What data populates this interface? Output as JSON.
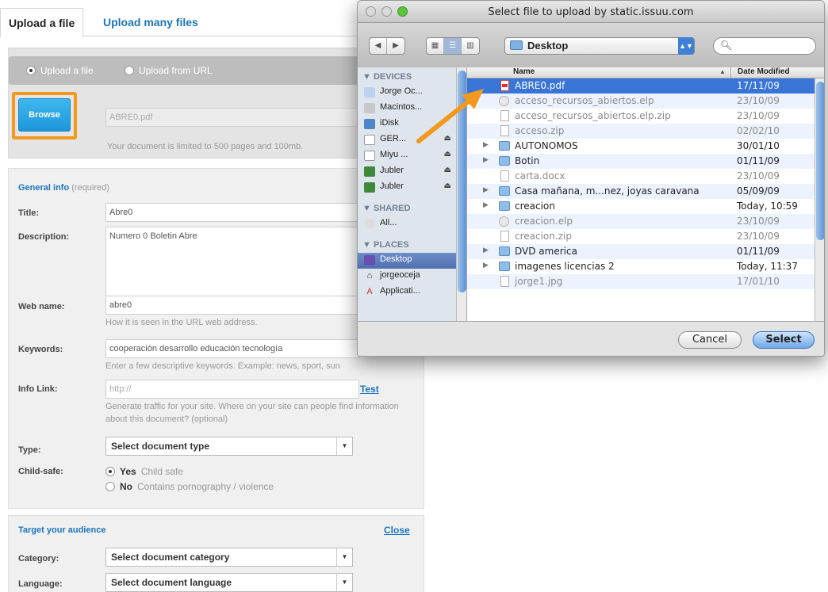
{
  "tabs": {
    "active": "Upload a file",
    "other": "Upload many files"
  },
  "upload": {
    "radio_file": "Upload a file",
    "radio_url": "Upload from URL",
    "browse_label": "Browse",
    "file_value": "ABRE0.pdf",
    "limit_hint": "Your document is limited to 500 pages and 100mb."
  },
  "general": {
    "title": "General info",
    "required": "(required)",
    "title_label": "Title:",
    "title_value": "Abre0",
    "description_label": "Description:",
    "description_value": "Numero 0 Boletin Abre",
    "webname_label": "Web name:",
    "webname_value": "abre0",
    "webname_hint": "How it is seen in the URL web address.",
    "keywords_label": "Keywords:",
    "keywords_value": "cooperación desarrollo educación tecnología",
    "keywords_hint": "Enter a few descriptive keywords. Example: news, sport, sun",
    "infolink_label": "Info Link:",
    "infolink_placeholder": "http://",
    "test_link": "Test",
    "infolink_hint": "Generate traffic for your site. Where on your site can people find information about this document? (optional)",
    "type_label": "Type:",
    "type_value": "Select document type",
    "childsafe_label": "Child-safe:",
    "yes_label": "Yes",
    "yes_sub": "Child safe",
    "no_label": "No",
    "no_sub": "Contains pornography / violence"
  },
  "target": {
    "title": "Target your audience",
    "close_link": "Close",
    "category_label": "Category:",
    "category_value": "Select document category",
    "language_label": "Language:",
    "language_value": "Select document language"
  },
  "dialog": {
    "title": "Select file to upload by static.issuu.com",
    "location": "Desktop",
    "search_value": "",
    "col_name": "Name",
    "col_date": "Date Modified",
    "sidebar": {
      "devices_head": "▼ DEVICES",
      "shared_head": "▼ SHARED",
      "places_head": "▼ PLACES",
      "devices": [
        "Jorge Oc...",
        "Macintos...",
        "iDisk",
        "GER...",
        "Miyu ...",
        "Jubler",
        "Jubler"
      ],
      "shared": [
        "All..."
      ],
      "places": [
        "Desktop",
        "jorgeoceja",
        "Applicati..."
      ]
    },
    "files": [
      {
        "name": "ABRE0.pdf",
        "date": "17/11/09"
      },
      {
        "name": "acceso_recursos_abiertos.elp",
        "date": "23/10/09"
      },
      {
        "name": "acceso_recursos_abiertos.elp.zip",
        "date": "23/10/09"
      },
      {
        "name": "acceso.zip",
        "date": "02/02/10"
      },
      {
        "name": "AUTONOMOS",
        "date": "30/01/10"
      },
      {
        "name": "Botin",
        "date": "01/11/09"
      },
      {
        "name": "carta.docx",
        "date": "23/10/09"
      },
      {
        "name": "Casa mañana, m...nez, joyas caravana",
        "date": "05/09/09"
      },
      {
        "name": "creacion",
        "date": "Today, 10:59"
      },
      {
        "name": "creacion.elp",
        "date": "23/10/09"
      },
      {
        "name": "creacion.zip",
        "date": "23/10/09"
      },
      {
        "name": "DVD america",
        "date": "01/11/09"
      },
      {
        "name": "imagenes licencias 2",
        "date": "Today, 11:37"
      },
      {
        "name": "jorge1.jpg",
        "date": "17/01/10"
      }
    ],
    "cancel_label": "Cancel",
    "select_label": "Select"
  },
  "colors": {
    "accent_orange": "#f39a1e",
    "link_blue": "#1b75bb",
    "selection_blue": "#3875d7"
  }
}
